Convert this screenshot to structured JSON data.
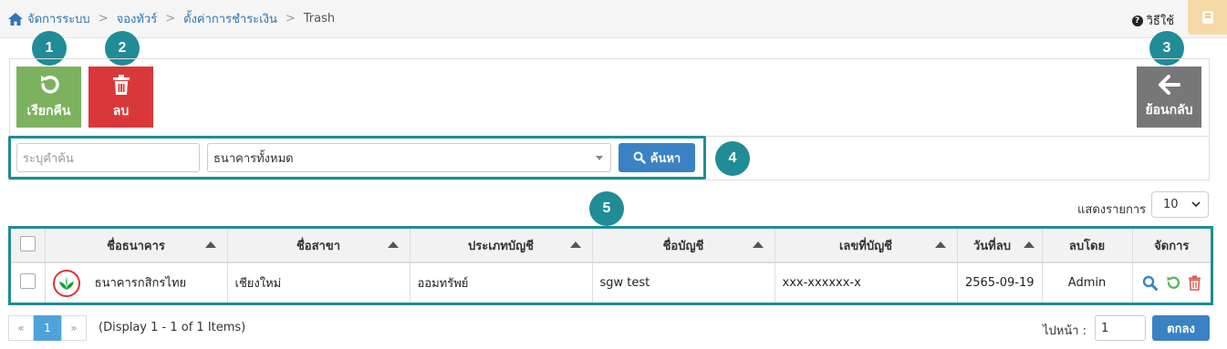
{
  "breadcrumb": {
    "items": [
      "จัดการระบบ",
      "จองทัวร์",
      "ตั้งค่าการชำระเงิน"
    ],
    "current": "Trash",
    "separator": ">"
  },
  "help": {
    "label": "วิธีใช้",
    "icon": "question-circle-icon"
  },
  "callouts": [
    "1",
    "2",
    "3",
    "4",
    "5"
  ],
  "toolbar": {
    "restore_label": "เรียกคืน",
    "delete_label": "ลบ",
    "back_label": "ย้อนกลับ"
  },
  "search": {
    "keyword_placeholder": "ระบุคำค้น",
    "bank_selected": "ธนาคารทั้งหมด",
    "button_label": "ค้นหา"
  },
  "page_size": {
    "label": "แสดงรายการ",
    "value": "10"
  },
  "table": {
    "columns": [
      "ชื่อธนาคาร",
      "ชื่อสาขา",
      "ประเภทบัญชี",
      "ชื่อบัญชี",
      "เลขที่บัญชี",
      "วันที่ลบ",
      "ลบโดย",
      "จัดการ"
    ],
    "rows": [
      {
        "bank": "ธนาคารกสิกรไทย",
        "branch": "เชียงใหม่",
        "account_type": "ออมทรัพย์",
        "account_name": "sgw test",
        "account_no": "xxx-xxxxxx-x",
        "deleted_date": "2565-09-19",
        "deleted_by": "Admin"
      }
    ]
  },
  "pagination": {
    "prev": "«",
    "current": "1",
    "next": "»",
    "info": "(Display 1 - 1 of 1 Items)",
    "goto_label": "ไปหน้า :",
    "goto_value": "1",
    "goto_button": "ตกลง"
  },
  "colors": {
    "accent": "#1f8c96",
    "restore": "#7cb25e",
    "delete": "#d9383a",
    "back": "#777777",
    "primary": "#3a82c4"
  }
}
